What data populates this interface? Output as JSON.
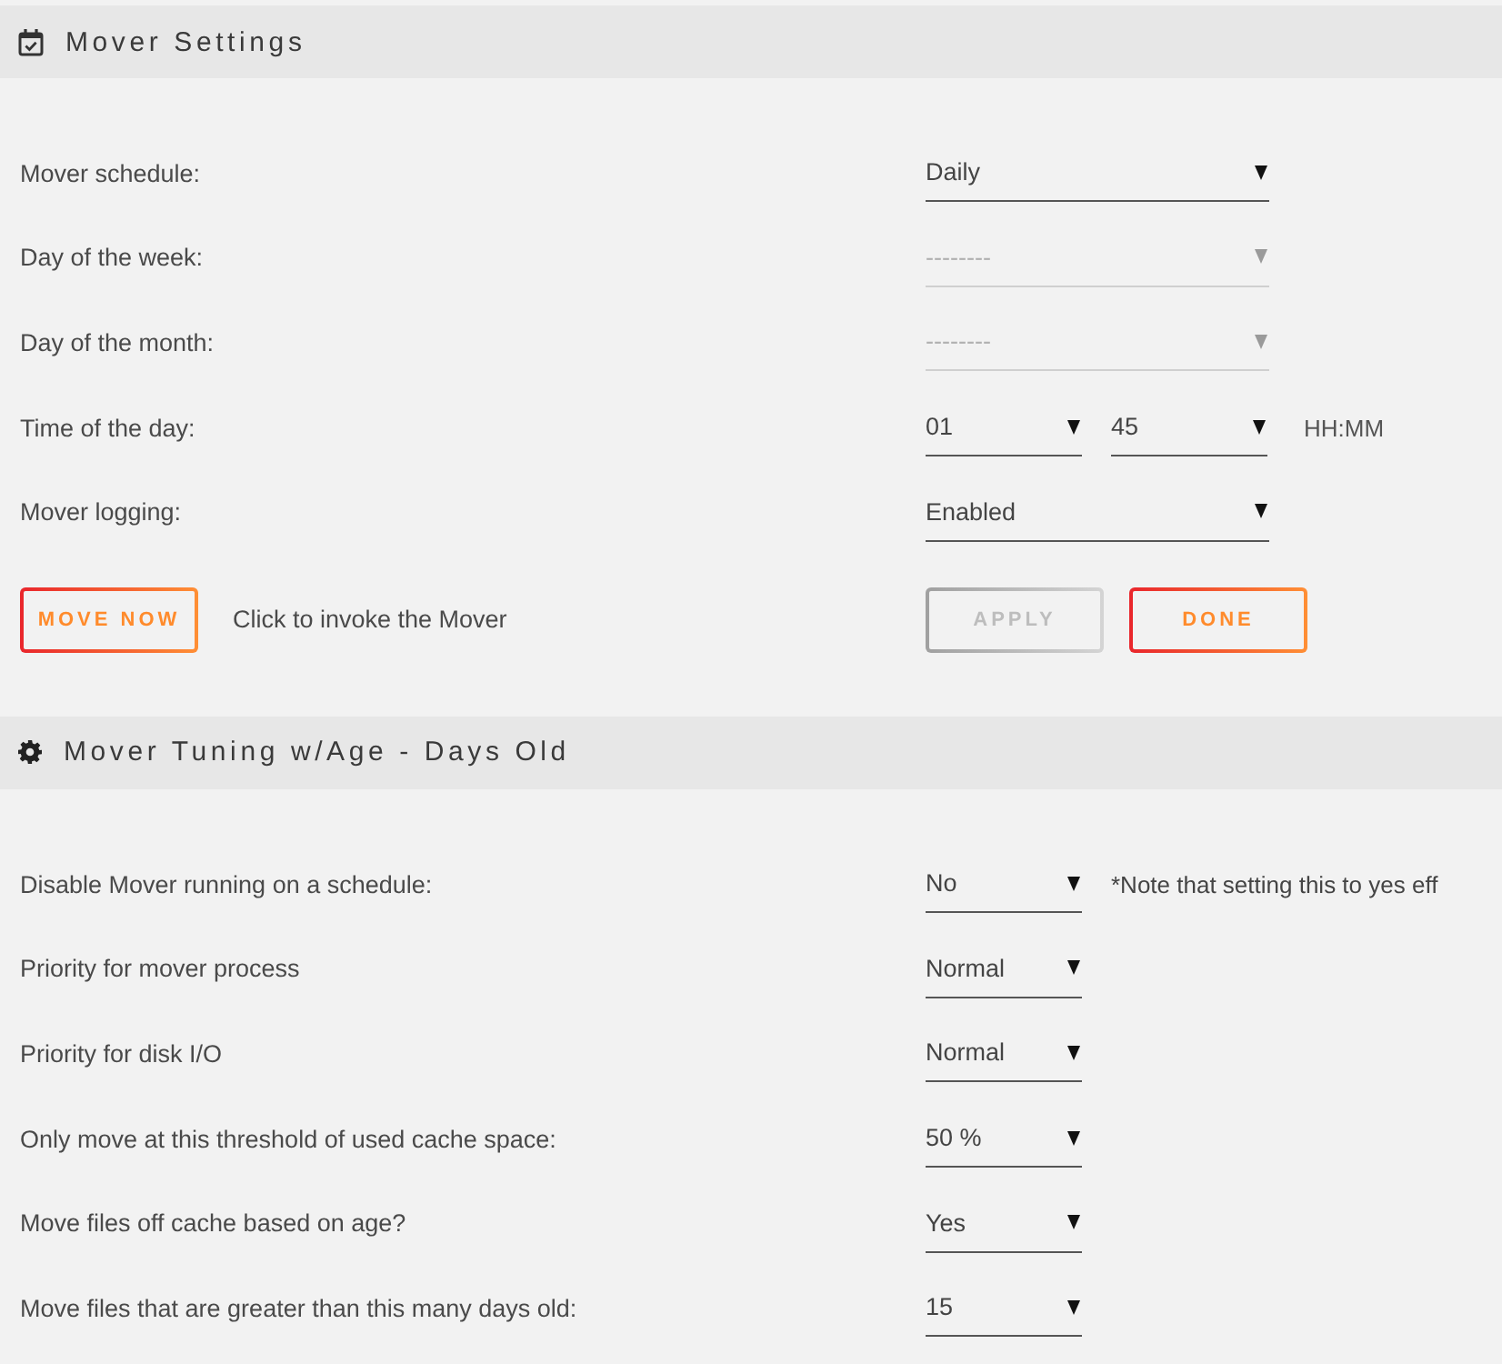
{
  "mover_settings": {
    "title": "Mover Settings",
    "rows": [
      {
        "label": "Mover schedule:",
        "fields": [
          {
            "value": "Daily",
            "disabled": false
          }
        ]
      },
      {
        "label": "Day of the week:",
        "fields": [
          {
            "value": "--------",
            "disabled": true
          }
        ]
      },
      {
        "label": "Day of the month:",
        "fields": [
          {
            "value": "--------",
            "disabled": true
          }
        ]
      },
      {
        "label": "Time of the day:",
        "fields": [
          {
            "value": "01",
            "disabled": false
          },
          {
            "value": "45",
            "disabled": false
          }
        ],
        "suffix": "HH:MM"
      },
      {
        "label": "Mover logging:",
        "fields": [
          {
            "value": "Enabled",
            "disabled": false
          }
        ]
      }
    ],
    "action": {
      "button": {
        "label": "MOVE NOW",
        "disabled": false
      },
      "description": "Click to invoke the Mover"
    },
    "buttons": [
      {
        "label": "APPLY",
        "disabled": true
      },
      {
        "label": "DONE",
        "disabled": false
      }
    ]
  },
  "mover_tuning": {
    "title": "Mover Tuning w/Age - Days Old",
    "rows": [
      {
        "label": "Disable Mover running on a schedule:",
        "fields": [
          {
            "value": "No",
            "disabled": false
          }
        ],
        "note": "*Note that setting this to yes eff"
      },
      {
        "label": "Priority for mover process",
        "fields": [
          {
            "value": "Normal",
            "disabled": false
          }
        ]
      },
      {
        "label": "Priority for disk I/O",
        "fields": [
          {
            "value": "Normal",
            "disabled": false
          }
        ]
      },
      {
        "label": "Only move at this threshold of used cache space:",
        "fields": [
          {
            "value": "50 %",
            "disabled": false
          }
        ]
      },
      {
        "label": "Move files off cache based on age?",
        "fields": [
          {
            "value": "Yes",
            "disabled": false
          }
        ]
      },
      {
        "label": "Move files that are greater than this many days old:",
        "fields": [
          {
            "value": "15",
            "disabled": false
          }
        ]
      }
    ]
  }
}
